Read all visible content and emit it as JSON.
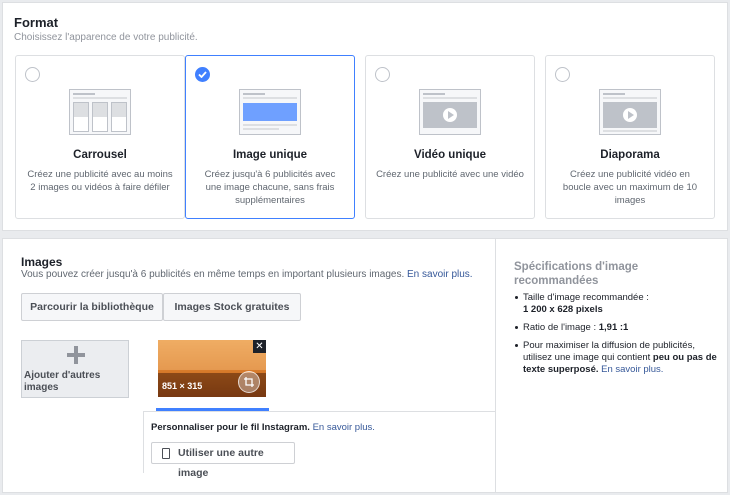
{
  "format": {
    "title": "Format",
    "subtitle": "Choisissez l'apparence de votre publicité.",
    "cards": [
      {
        "title": "Carrousel",
        "desc": "Créez une publicité avec au moins 2 images ou vidéos à faire défiler",
        "selected": false
      },
      {
        "title": "Image unique",
        "desc": "Créez jusqu'à 6 publicités avec une image chacune, sans frais supplémentaires",
        "selected": true
      },
      {
        "title": "Vidéo unique",
        "desc": "Créez une publicité avec une vidéo",
        "selected": false
      },
      {
        "title": "Diaporama",
        "desc": "Créez une publicité vidéo en boucle avec un maximum de 10 images",
        "selected": false
      }
    ]
  },
  "images": {
    "title": "Images",
    "subtitle": "Vous pouvez créer jusqu'à 6 publicités en même temps en important plusieurs images.",
    "learn_more": "En savoir plus.",
    "browse_library": "Parcourir la bibliothèque",
    "stock_images": "Images Stock gratuites",
    "add_images": "Ajouter d'autres images",
    "image_size_label": "851 × 315",
    "instagram_text": "Personnaliser pour le fil Instagram.",
    "instagram_link": "En savoir plus.",
    "use_other_image": "Utiliser une autre image"
  },
  "specs": {
    "title": "Spécifications d'image recommandées",
    "item1_label": "Taille d'image recommandée :",
    "item1_value": "1 200 x 628 pixels",
    "item2_label": "Ratio de l'image :",
    "item2_value": "1,91 :1",
    "item3_text": "Pour maximiser la diffusion de publicités, utilisez une image qui contient",
    "item3_bold": "peu ou pas de texte superposé.",
    "item3_link": "En savoir plus."
  },
  "colors": {
    "accent": "#4080ff",
    "link": "#365899"
  }
}
